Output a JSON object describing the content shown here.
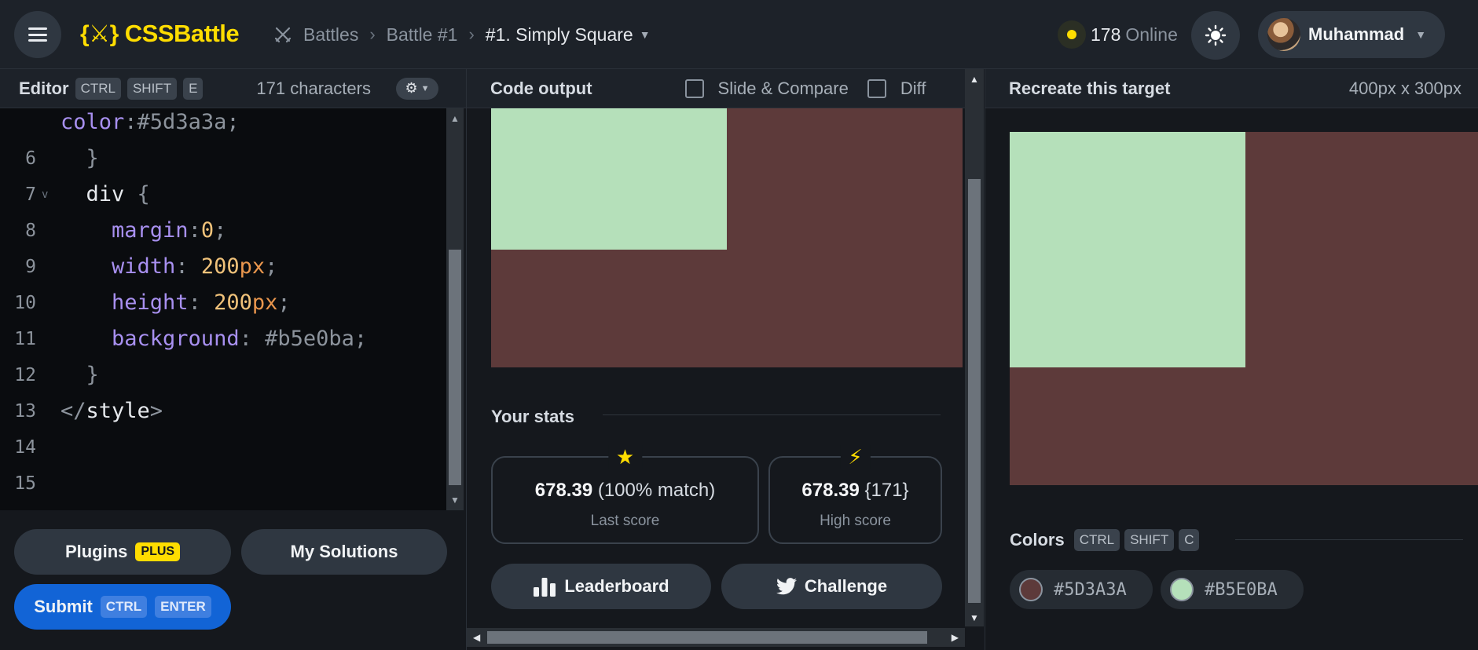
{
  "header": {
    "app_name": "CSSBattle",
    "logo_mark": "{⚔}",
    "breadcrumb": [
      "Battles",
      "Battle #1",
      "#1. Simply Square"
    ],
    "online_count": "178",
    "online_label": "Online",
    "user_name": "Muhammad"
  },
  "editor": {
    "title": "Editor",
    "shortcut": [
      "CTRL",
      "SHIFT",
      "E"
    ],
    "char_count": "171 characters",
    "lines": [
      {
        "num": "",
        "fold": "",
        "tokens": [
          [
            "prop",
            "color"
          ],
          [
            "punc",
            ":"
          ],
          [
            "hex",
            "#5d3a3a"
          ],
          [
            "punc",
            ";"
          ]
        ]
      },
      {
        "num": "6",
        "fold": "",
        "tokens": [
          [
            "punc",
            "  }"
          ]
        ]
      },
      {
        "num": "7",
        "fold": "v",
        "tokens": [
          [
            "sel",
            "  div "
          ],
          [
            "punc",
            "{"
          ]
        ]
      },
      {
        "num": "8",
        "fold": "",
        "tokens": [
          [
            "prop",
            "    margin"
          ],
          [
            "punc",
            ":"
          ],
          [
            "val",
            "0"
          ],
          [
            "punc",
            ";"
          ]
        ]
      },
      {
        "num": "9",
        "fold": "",
        "tokens": [
          [
            "prop",
            "    width"
          ],
          [
            "punc",
            ": "
          ],
          [
            "val",
            "200"
          ],
          [
            "unit",
            "px"
          ],
          [
            "punc",
            ";"
          ]
        ]
      },
      {
        "num": "10",
        "fold": "",
        "tokens": [
          [
            "prop",
            "    height"
          ],
          [
            "punc",
            ": "
          ],
          [
            "val",
            "200"
          ],
          [
            "unit",
            "px"
          ],
          [
            "punc",
            ";"
          ]
        ]
      },
      {
        "num": "11",
        "fold": "",
        "tokens": [
          [
            "prop",
            "    background"
          ],
          [
            "punc",
            ": "
          ],
          [
            "hex",
            "#b5e0ba"
          ],
          [
            "punc",
            ";"
          ]
        ]
      },
      {
        "num": "12",
        "fold": "",
        "tokens": [
          [
            "punc",
            "  }"
          ]
        ]
      },
      {
        "num": "13",
        "fold": "",
        "tokens": [
          [
            "punc",
            "</"
          ],
          [
            "tag",
            "style"
          ],
          [
            "punc",
            ">"
          ]
        ]
      },
      {
        "num": "14",
        "fold": "",
        "tokens": []
      },
      {
        "num": "15",
        "fold": "",
        "tokens": []
      }
    ],
    "plugins_label": "Plugins",
    "plugins_badge": "PLUS",
    "my_solutions_label": "My Solutions",
    "submit_label": "Submit",
    "submit_shortcut": [
      "CTRL",
      "ENTER"
    ]
  },
  "output": {
    "title": "Code output",
    "slide_compare_label": "Slide & Compare",
    "diff_label": "Diff",
    "background_color": "#5d3a3a",
    "square_color": "#b5e0ba",
    "stats_title": "Your stats",
    "last_score_value": "678.39",
    "last_score_detail": "(100% match)",
    "last_score_label": "Last score",
    "high_score_value": "678.39",
    "high_score_detail": "{171}",
    "high_score_label": "High score",
    "leaderboard_label": "Leaderboard",
    "challenge_label": "Challenge"
  },
  "target": {
    "title": "Recreate this target",
    "size": "400px x 300px",
    "colors_title": "Colors",
    "colors_shortcut": [
      "CTRL",
      "SHIFT",
      "C"
    ],
    "colors": [
      {
        "hex": "#5D3A3A",
        "value": "#5d3a3a"
      },
      {
        "hex": "#B5E0BA",
        "value": "#b5e0ba"
      }
    ]
  }
}
